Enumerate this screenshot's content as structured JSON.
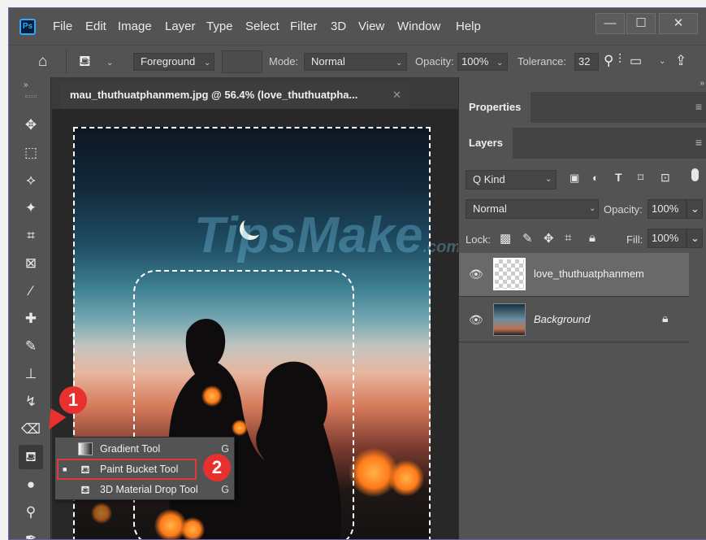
{
  "app": {
    "logo": "Ps"
  },
  "menu": [
    "File",
    "Edit",
    "Image",
    "Layer",
    "Type",
    "Select",
    "Filter",
    "3D",
    "View",
    "Window",
    "Help"
  ],
  "window_controls": {
    "minimize": "—",
    "maximize": "☐",
    "close": "✕"
  },
  "options_bar": {
    "fill_source": "Foreground",
    "mode_label": "Mode:",
    "mode_value": "Normal",
    "opacity_label": "Opacity:",
    "opacity_value": "100%",
    "tolerance_label": "Tolerance:",
    "tolerance_value": "32"
  },
  "document": {
    "tab_title": "mau_thuthuatphanmem.jpg @ 56.4% (love_thuthuatpha...",
    "watermark": "TipsMake",
    "watermark_suffix": ".com"
  },
  "tool_flyout": {
    "items": [
      {
        "name": "Gradient Tool",
        "key": "G",
        "icon": "gradient-icon"
      },
      {
        "name": "Paint Bucket Tool",
        "key": "",
        "icon": "paint-bucket-icon",
        "active": true
      },
      {
        "name": "3D Material Drop Tool",
        "key": "G",
        "icon": "3d-material-drop-icon"
      }
    ]
  },
  "annotations": {
    "step1": "1",
    "step2": "2",
    "color": "#e8302f"
  },
  "panels": {
    "properties_tab": "Properties",
    "layers_tab": "Layers",
    "filter_kind": "Q Kind",
    "blend_mode": "Normal",
    "opacity_label": "Opacity:",
    "opacity_value": "100%",
    "lock_label": "Lock:",
    "fill_label": "Fill:",
    "fill_value": "100%",
    "layers": [
      {
        "name": "love_thuthuatphanmem",
        "selected": true
      },
      {
        "name": "Background",
        "locked": true
      }
    ]
  }
}
